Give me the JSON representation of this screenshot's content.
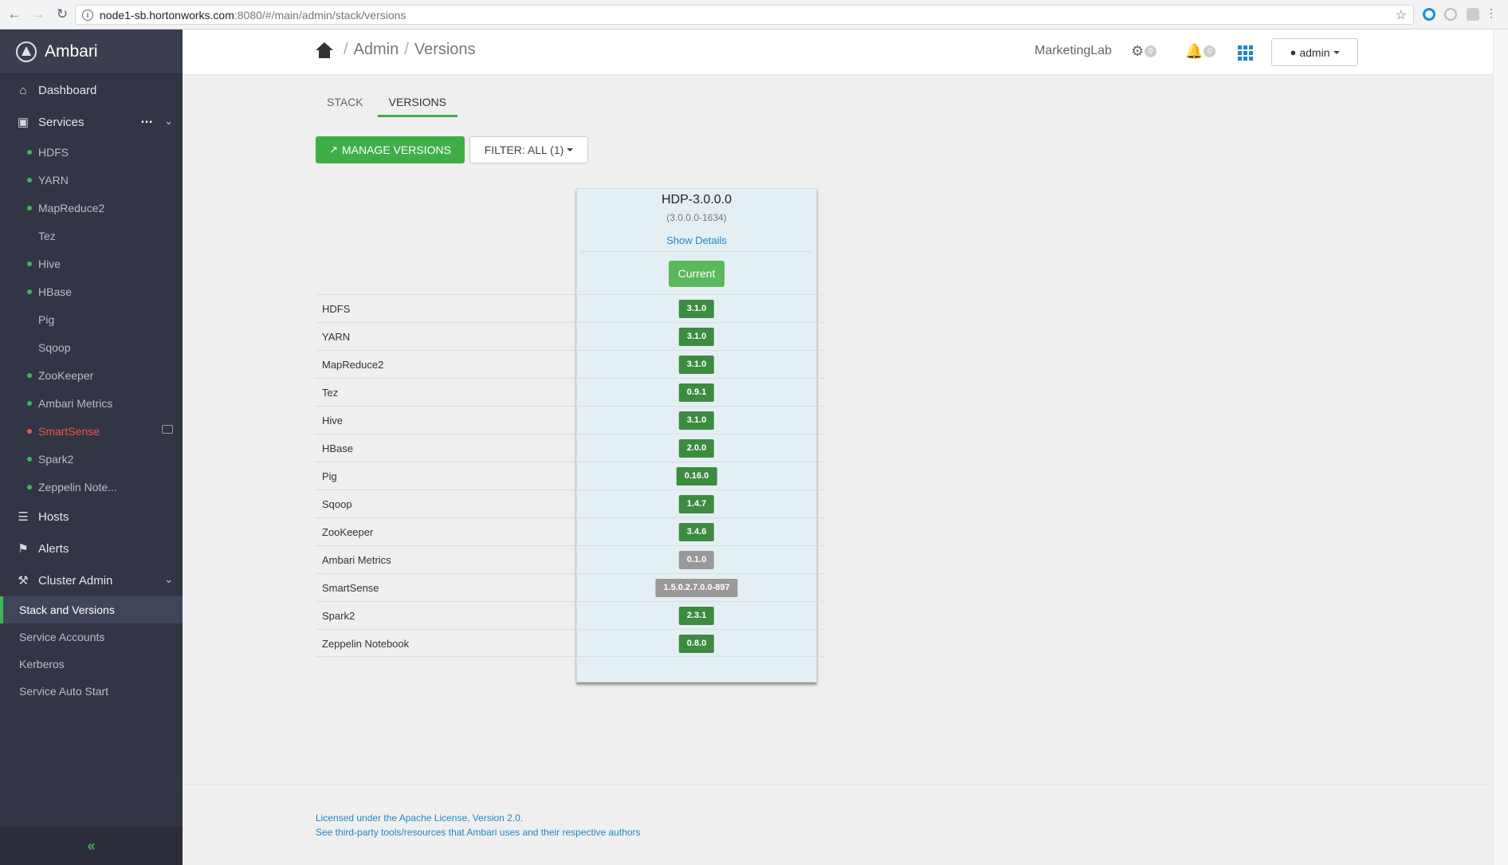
{
  "browser": {
    "url_host": "node1-sb.hortonworks.com",
    "url_path": ":8080/#/main/admin/stack/versions"
  },
  "sidebar": {
    "brand": "Ambari",
    "dashboard": "Dashboard",
    "services_label": "Services",
    "services": [
      {
        "label": "HDFS",
        "status": "ok"
      },
      {
        "label": "YARN",
        "status": "ok"
      },
      {
        "label": "MapReduce2",
        "status": "ok"
      },
      {
        "label": "Tez",
        "status": "none"
      },
      {
        "label": "Hive",
        "status": "ok"
      },
      {
        "label": "HBase",
        "status": "ok"
      },
      {
        "label": "Pig",
        "status": "none"
      },
      {
        "label": "Sqoop",
        "status": "none"
      },
      {
        "label": "ZooKeeper",
        "status": "ok"
      },
      {
        "label": "Ambari Metrics",
        "status": "ok"
      },
      {
        "label": "SmartSense",
        "status": "alert"
      },
      {
        "label": "Spark2",
        "status": "ok"
      },
      {
        "label": "Zeppelin Note...",
        "status": "ok"
      }
    ],
    "hosts": "Hosts",
    "alerts": "Alerts",
    "cluster_admin": "Cluster Admin",
    "cluster_admin_items": [
      "Stack and Versions",
      "Service Accounts",
      "Kerberos",
      "Service Auto Start"
    ],
    "collapse": "«"
  },
  "header": {
    "crumb_admin": "Admin",
    "crumb_versions": "Versions",
    "separator": "/",
    "cluster_name": "MarketingLab",
    "ops_count": "0",
    "alerts_count": "0",
    "user": "admin"
  },
  "tabs": {
    "stack": "STACK",
    "versions": "VERSIONS"
  },
  "actions": {
    "manage_versions": "MANAGE VERSIONS",
    "filter": "FILTER: ALL (1)"
  },
  "version": {
    "name": "HDP-3.0.0.0",
    "build": "(3.0.0.0-1634)",
    "show_details": "Show Details",
    "status": "Current"
  },
  "components": [
    {
      "name": "HDFS",
      "version": "3.1.0",
      "style": "green"
    },
    {
      "name": "YARN",
      "version": "3.1.0",
      "style": "green"
    },
    {
      "name": "MapReduce2",
      "version": "3.1.0",
      "style": "green"
    },
    {
      "name": "Tez",
      "version": "0.9.1",
      "style": "green"
    },
    {
      "name": "Hive",
      "version": "3.1.0",
      "style": "green"
    },
    {
      "name": "HBase",
      "version": "2.0.0",
      "style": "green"
    },
    {
      "name": "Pig",
      "version": "0.16.0",
      "style": "green"
    },
    {
      "name": "Sqoop",
      "version": "1.4.7",
      "style": "green"
    },
    {
      "name": "ZooKeeper",
      "version": "3.4.6",
      "style": "green"
    },
    {
      "name": "Ambari Metrics",
      "version": "0.1.0",
      "style": "gray"
    },
    {
      "name": "SmartSense",
      "version": "1.5.0.2.7.0.0-897",
      "style": "gray"
    },
    {
      "name": "Spark2",
      "version": "2.3.1",
      "style": "green"
    },
    {
      "name": "Zeppelin Notebook",
      "version": "0.8.0",
      "style": "green"
    }
  ],
  "footer": {
    "license": "Licensed under the Apache License, Version 2.0.",
    "third_party": "See third-party tools/resources that Ambari uses and their respective authors"
  },
  "colors": {
    "sidebar_bg": "#323544",
    "accent_green": "#3fae49",
    "link_blue": "#1e88c9",
    "alert_red": "#e8564f"
  }
}
